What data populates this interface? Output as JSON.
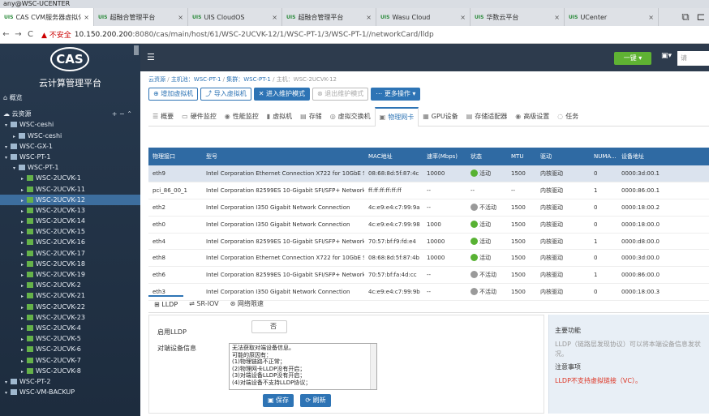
{
  "window": {
    "user": "any@WSC-UCENTER"
  },
  "tabs": [
    {
      "label": "CAS CVM服务器虚拟化",
      "active": true
    },
    {
      "label": "超融合管理平台"
    },
    {
      "label": "UIS CloudOS"
    },
    {
      "label": "超融合管理平台"
    },
    {
      "label": "Wasu Cloud"
    },
    {
      "label": "华数云平台"
    },
    {
      "label": "UCenter"
    }
  ],
  "addr": {
    "warn": "▲ 不安全",
    "host": "10.150.200.200",
    "path": ":8080/cas/main/host/61/WSC-2UCVK-12/1/WSC-PT-1/3/WSC-PT-1//networkCard/lldp"
  },
  "sidebar": {
    "title": "云计算管理平台",
    "overview": "概览",
    "resource": "云资源",
    "items": [
      {
        "label": "WSC-ceshi",
        "lvl": 0,
        "icon": "tree-icon"
      },
      {
        "label": "WSC-ceshi",
        "lvl": 1,
        "icon": "cluster-icon"
      },
      {
        "label": "WSC-GX-1",
        "lvl": 0,
        "icon": "tree-icon"
      },
      {
        "label": "WSC-PT-1",
        "lvl": 0,
        "icon": "tree-icon"
      },
      {
        "label": "WSC-PT-1",
        "lvl": 1,
        "icon": "cluster-icon"
      },
      {
        "label": "WSC-2UCVK-1",
        "lvl": 2,
        "icon": "host-icon"
      },
      {
        "label": "WSC-2UCVK-11",
        "lvl": 2,
        "icon": "host-icon"
      },
      {
        "label": "WSC-2UCVK-12",
        "lvl": 2,
        "icon": "host-icon",
        "selected": true
      },
      {
        "label": "WSC-2UCVK-13",
        "lvl": 2,
        "icon": "host-icon"
      },
      {
        "label": "WSC-2UCVK-14",
        "lvl": 2,
        "icon": "host-icon"
      },
      {
        "label": "WSC-2UCVK-15",
        "lvl": 2,
        "icon": "host-icon"
      },
      {
        "label": "WSC-2UCVK-16",
        "lvl": 2,
        "icon": "host-icon"
      },
      {
        "label": "WSC-2UCVK-17",
        "lvl": 2,
        "icon": "host-icon"
      },
      {
        "label": "WSC-2UCVK-18",
        "lvl": 2,
        "icon": "host-icon"
      },
      {
        "label": "WSC-2UCVK-19",
        "lvl": 2,
        "icon": "host-icon"
      },
      {
        "label": "WSC-2UCVK-2",
        "lvl": 2,
        "icon": "host-icon"
      },
      {
        "label": "WSC-2UCVK-21",
        "lvl": 2,
        "icon": "host-icon"
      },
      {
        "label": "WSC-2UCVK-22",
        "lvl": 2,
        "icon": "host-icon"
      },
      {
        "label": "WSC-2UCVK-23",
        "lvl": 2,
        "icon": "host-icon"
      },
      {
        "label": "WSC-2UCVK-4",
        "lvl": 2,
        "icon": "host-icon"
      },
      {
        "label": "WSC-2UCVK-5",
        "lvl": 2,
        "icon": "host-icon"
      },
      {
        "label": "WSC-2UCVK-6",
        "lvl": 2,
        "icon": "host-icon"
      },
      {
        "label": "WSC-2UCVK-7",
        "lvl": 2,
        "icon": "host-icon"
      },
      {
        "label": "WSC-2UCVK-8",
        "lvl": 2,
        "icon": "host-icon"
      },
      {
        "label": "WSC-PT-2",
        "lvl": 0,
        "icon": "tree-icon"
      },
      {
        "label": "WSC-VM-BACKUP",
        "lvl": 0,
        "icon": "tree-icon"
      }
    ]
  },
  "header": {
    "btn": "一键",
    "search": "请"
  },
  "breadcrumb": [
    "云资源",
    "主机池：WSC-PT-1",
    "集群：WSC-PT-1",
    "主机：WSC-2UCVK-12"
  ],
  "actions": [
    {
      "label": "增加虚拟机",
      "dis": false
    },
    {
      "label": "导入虚拟机",
      "dis": false
    },
    {
      "label": "进入维护模式",
      "dis": false,
      "blue": true
    },
    {
      "label": "退出维护模式",
      "dis": true
    },
    {
      "label": "更多操作 ▾",
      "dis": false,
      "blue": true
    }
  ],
  "vtabs": [
    "概要",
    "硬件监控",
    "性能监控",
    "虚拟机",
    "存储",
    "虚拟交换机",
    "物理网卡",
    "GPU设备",
    "存储适配器",
    "高级设置",
    "任务"
  ],
  "table": {
    "headers": [
      "物理接口",
      "型号",
      "MAC地址",
      "速率(Mbps)",
      "状态",
      "MTU",
      "驱动",
      "NUMA...",
      "设备地址"
    ],
    "rows": [
      [
        "eth9",
        "Intel Corporation Ethernet Connection X722 for 10GbE S...",
        "08:68:8d:5f:87:4c",
        "10000",
        "活动",
        "1500",
        "内核驱动",
        "0",
        "0000:3d:00.1"
      ],
      [
        "pci_86_00_1",
        "Intel Corporation 82599ES 10-Gigabit SFI/SFP+ Network...",
        "ff:ff:ff:ff:ff:ff",
        "--",
        "--",
        "--",
        "内核驱动",
        "1",
        "0000:86:00.1"
      ],
      [
        "eth2",
        "Intel Corporation I350 Gigabit Network Connection",
        "4c:e9:e4:c7:99:9a",
        "--",
        "不活动",
        "1500",
        "内核驱动",
        "0",
        "0000:18:00.2"
      ],
      [
        "eth0",
        "Intel Corporation I350 Gigabit Network Connection",
        "4c:e9:e4:c7:99:98",
        "1000",
        "活动",
        "1500",
        "内核驱动",
        "0",
        "0000:18:00.0"
      ],
      [
        "eth4",
        "Intel Corporation 82599ES 10-Gigabit SFI/SFP+ Network...",
        "70:57:bf:f9:fd:e4",
        "10000",
        "活动",
        "1500",
        "内核驱动",
        "1",
        "0000:d8:00.0"
      ],
      [
        "eth8",
        "Intel Corporation Ethernet Connection X722 for 10GbE S...",
        "08:68:8d:5f:87:4b",
        "10000",
        "活动",
        "1500",
        "内核驱动",
        "0",
        "0000:3d:00.0"
      ],
      [
        "eth6",
        "Intel Corporation 82599ES 10-Gigabit SFI/SFP+ Network...",
        "70:57:bf:fa:4d:cc",
        "--",
        "不活动",
        "1500",
        "内核驱动",
        "1",
        "0000:86:00.0"
      ],
      [
        "eth3",
        "Intel Corporation I350 Gigabit Network Connection",
        "4c:e9:e4:c7:99:9b",
        "--",
        "不活动",
        "1500",
        "内核驱动",
        "0",
        "0000:18:00.3"
      ]
    ]
  },
  "btabs": [
    "LLDP",
    "SR-IOV",
    "网络限速"
  ],
  "lldp": {
    "enable_label": "启用LLDP",
    "toggle": "否",
    "peer_label": "对端设备信息",
    "text_lines": [
      "无法获取对端设备信息。",
      "可能的原因有：",
      "(1)物理链路不正常；",
      "(2)物理网卡LLDP没有开启；",
      "(3)对端设备LLDP没有开启；",
      "(4)对端设备不支持LLDP协议；"
    ],
    "save": "保存",
    "refresh": "刷新"
  },
  "info": {
    "h1": "主要功能",
    "t1": "LLDP（链路层发现协议）可以将本端设备信息发状况。",
    "h2": "注意事项",
    "t2": "LLDP不支持虚拟链接（VC）。"
  }
}
